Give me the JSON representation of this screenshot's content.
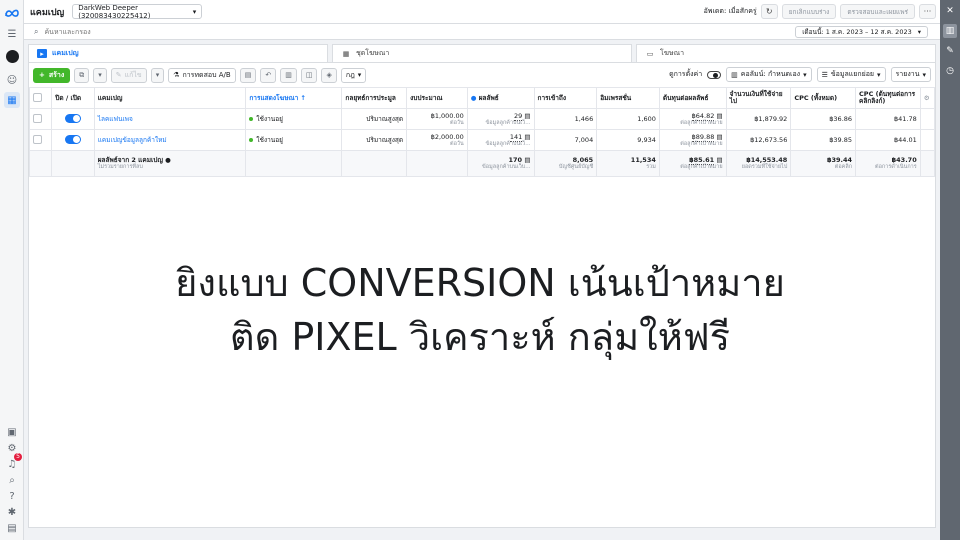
{
  "header": {
    "title": "แคมเปญ",
    "account": "DarkWeb Deeper (320083430225412)",
    "status_text": "อัพเดต: เมื่อสักครู่",
    "discard_label": "ยกเลิกแบบร่าง",
    "review_label": "ตรวจสอบและเผยแพร่"
  },
  "search": {
    "placeholder": "ค้นหาและกรอง",
    "date_range": "เดือนนี้: 1 ส.ค. 2023 – 12 ส.ค. 2023"
  },
  "tabs": [
    {
      "label": "แคมเปญ"
    },
    {
      "label": "ชุดโฆษณา"
    },
    {
      "label": "โฆษณา"
    }
  ],
  "toolbar": {
    "create_label": "สร้าง",
    "edit_label": "แก้ไข",
    "ab_test_label": "การทดสอบ A/B",
    "rules_label": "กฎ",
    "view_setup_label": "ดูการตั้งค่า",
    "columns_label": "คอลัมน์: กำหนดเอง",
    "breakdown_label": "ข้อมูลแยกย่อย",
    "reports_label": "รายงาน"
  },
  "table": {
    "headers": [
      "ปิด / เปิด",
      "แคมเปญ",
      "การแสดงโฆษณา ↑",
      "กลยุทธ์การประมูล",
      "งบประมาณ",
      "ผลลัพธ์",
      "การเข้าถึง",
      "อิมเพรสชั่น",
      "ต้นทุนต่อผลลัพธ์",
      "จำนวนเงินที่ใช้จ่ายไป",
      "CPC (ทั้งหมด)",
      "CPC (ต้นทุนต่อการคลิกลิงก์)"
    ],
    "rows": [
      {
        "name": "ไลคแฟนเพจ",
        "delivery": "ใช้งานอยู่",
        "bid": "ปริมาณสูงสุด",
        "budget": "฿1,000.00",
        "budget_sub": "ต่อวัน",
        "results": "29",
        "results_sub": "ข้อมูลลูกค้าบนเว็...",
        "reach": "1,466",
        "impressions": "1,600",
        "cpr": "฿64.82",
        "cpr_sub": "ต่อลูกค้าเป้าหมาย",
        "spent": "฿1,879.92",
        "cpc_all": "฿36.86",
        "cpc_link": "฿41.78"
      },
      {
        "name": "แคมเปญข้อมูลลูกค้าใหม่",
        "delivery": "ใช้งานอยู่",
        "bid": "ปริมาณสูงสุด",
        "budget": "฿2,000.00",
        "budget_sub": "ต่อวัน",
        "results": "141",
        "results_sub": "ข้อมูลลูกค้าบนเว็...",
        "reach": "7,004",
        "impressions": "9,934",
        "cpr": "฿89.88",
        "cpr_sub": "ต่อลูกค้าเป้าหมาย",
        "spent": "฿12,673.56",
        "cpc_all": "฿39.85",
        "cpc_link": "฿44.01"
      }
    ],
    "total": {
      "name": "ผลลัพธ์จาก 2 แคมเปญ",
      "name_sub": "ไม่รวมรายการที่ลบ",
      "results": "170",
      "results_sub": "ข้อมูลลูกค้าบนเว็บ...",
      "reach": "8,065",
      "reach_sub": "บัญชีศูนย์บัญชี",
      "impressions": "11,534",
      "impressions_sub": "รวม",
      "cpr": "฿85.61",
      "cpr_sub": "ต่อลูกค้าเป้าหมาย",
      "spent": "฿14,553.48",
      "spent_sub": "ยอดรวมที่ใช้จ่ายไป",
      "cpc_all": "฿39.44",
      "cpc_all_sub": "ต่อคลิก",
      "cpc_link": "฿43.70",
      "cpc_link_sub": "ต่อการดำเนินการ"
    }
  },
  "overlay": {
    "line1": "ยิงแบบ CONVERSION เน้นเป้าหมาย",
    "line2": "ติด PIXEL วิเคราะห์ กลุ่มให้ฟรี"
  },
  "rail": {
    "notification_count": "5"
  },
  "colors": {
    "accent": "#1877f2",
    "create": "#42b72a"
  }
}
